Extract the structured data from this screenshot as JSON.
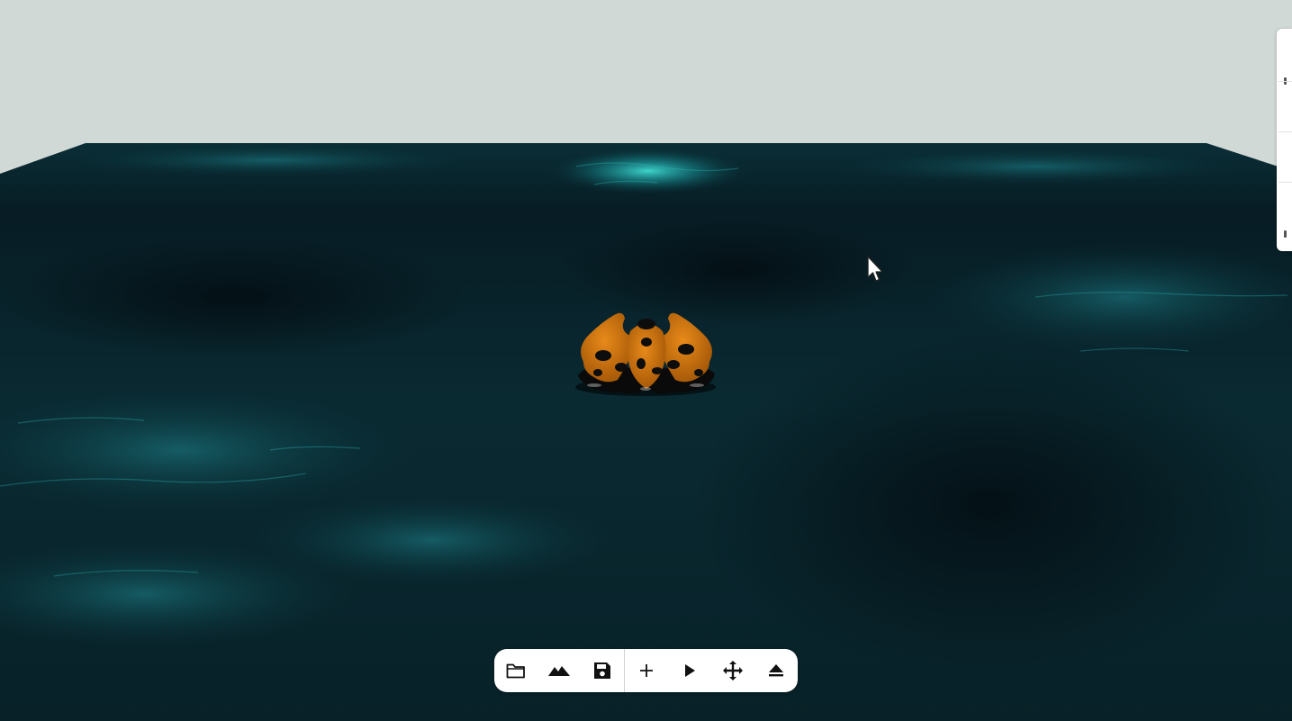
{
  "scene": {
    "background_color": "#d1d9d6",
    "ground_colors": [
      "#04141b",
      "#0b3e48",
      "#2fd6d0"
    ],
    "model_colors": [
      "#c7710f",
      "#0c0c0c"
    ]
  },
  "toolbar": {
    "left_tools": [
      {
        "name": "open-folder-icon"
      },
      {
        "name": "terrain-icon"
      },
      {
        "name": "save-icon"
      }
    ],
    "right_tools": [
      {
        "name": "add-icon"
      },
      {
        "name": "play-icon"
      },
      {
        "name": "move-icon"
      },
      {
        "name": "eject-icon"
      }
    ]
  }
}
